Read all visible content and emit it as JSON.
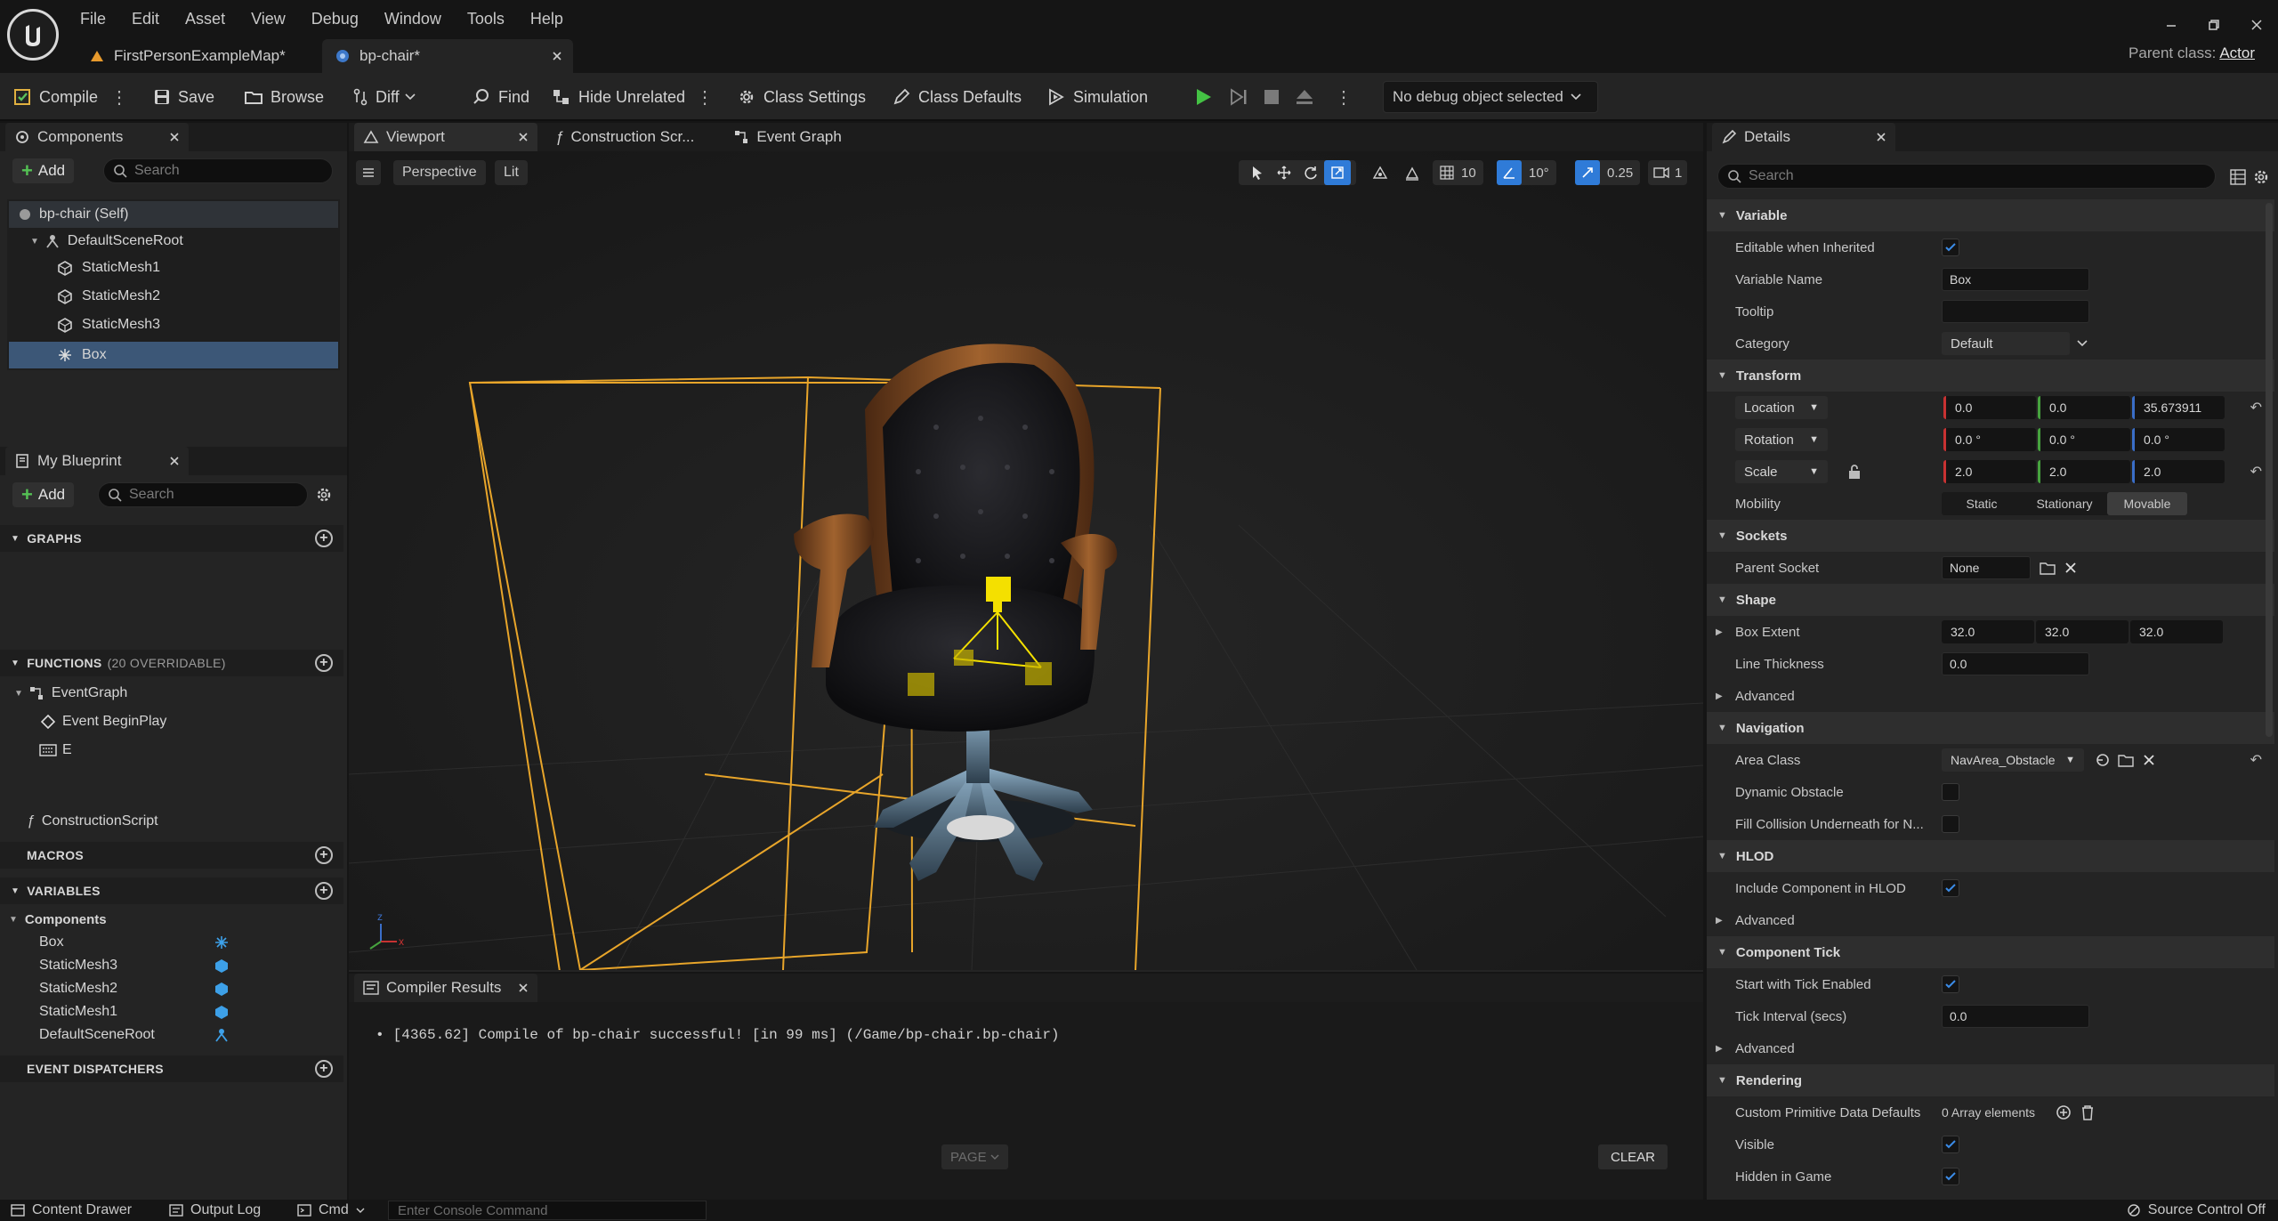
{
  "menu": [
    "File",
    "Edit",
    "Asset",
    "View",
    "Debug",
    "Window",
    "Tools",
    "Help"
  ],
  "doc_tabs": {
    "map": "FirstPersonExampleMap*",
    "bp": "bp-chair*"
  },
  "parent_class": {
    "label": "Parent class:",
    "value": "Actor"
  },
  "toolbar": {
    "compile": "Compile",
    "save": "Save",
    "browse": "Browse",
    "diff": "Diff",
    "find": "Find",
    "hide_unrelated": "Hide Unrelated",
    "class_settings": "Class Settings",
    "class_defaults": "Class Defaults",
    "simulation": "Simulation",
    "debug_object": "No debug object selected"
  },
  "components": {
    "title": "Components",
    "add": "Add",
    "search_placeholder": "Search",
    "items": [
      "bp-chair (Self)",
      "DefaultSceneRoot",
      "StaticMesh1",
      "StaticMesh2",
      "StaticMesh3",
      "Box"
    ]
  },
  "my_blueprint": {
    "title": "My Blueprint",
    "add": "Add",
    "search_placeholder": "Search",
    "graphs_label": "GRAPHS",
    "graphs": [
      "EventGraph",
      "Event BeginPlay",
      "E"
    ],
    "functions_label": "FUNCTIONS",
    "functions_count": "(20 OVERRIDABLE)",
    "functions": [
      "ConstructionScript"
    ],
    "macros_label": "MACROS",
    "variables_label": "VARIABLES",
    "var_group": "Components",
    "variables": [
      "Box",
      "StaticMesh3",
      "StaticMesh2",
      "StaticMesh1",
      "DefaultSceneRoot"
    ],
    "dispatchers_label": "EVENT DISPATCHERS"
  },
  "editor_tabs": {
    "viewport": "Viewport",
    "construction": "Construction Scr...",
    "event_graph": "Event Graph"
  },
  "viewport": {
    "perspective": "Perspective",
    "lit": "Lit",
    "grid_snap": "10",
    "rot_snap": "10°",
    "scale_snap": "0.25",
    "camera_speed": "1"
  },
  "compiler": {
    "title": "Compiler Results",
    "message": "[4365.62] Compile of bp-chair successful! [in 99 ms] (/Game/bp-chair.bp-chair)",
    "page": "PAGE",
    "clear": "CLEAR"
  },
  "details": {
    "title": "Details",
    "search_placeholder": "Search",
    "variable": {
      "cat": "Variable",
      "editable_inherited": "Editable when Inherited",
      "var_name_label": "Variable Name",
      "var_name": "Box",
      "tooltip_label": "Tooltip",
      "category_label": "Category",
      "category": "Default"
    },
    "transform": {
      "cat": "Transform",
      "location": "Location",
      "rotation": "Rotation",
      "scale": "Scale",
      "mobility": "Mobility",
      "loc": [
        "0.0",
        "0.0",
        "35.673911"
      ],
      "rot": [
        "0.0 °",
        "0.0 °",
        "0.0 °"
      ],
      "scl": [
        "2.0",
        "2.0",
        "2.0"
      ],
      "mobility_opts": [
        "Static",
        "Stationary",
        "Movable"
      ]
    },
    "sockets": {
      "cat": "Sockets",
      "parent_socket": "Parent Socket",
      "value": "None"
    },
    "shape": {
      "cat": "Shape",
      "box_extent": "Box Extent",
      "extent": [
        "32.0",
        "32.0",
        "32.0"
      ],
      "line_thickness": "Line Thickness",
      "thickness": "0.0",
      "advanced": "Advanced"
    },
    "navigation": {
      "cat": "Navigation",
      "area_class": "Area Class",
      "area_value": "NavArea_Obstacle",
      "dynamic_obstacle": "Dynamic Obstacle",
      "fill_collision": "Fill Collision Underneath for N..."
    },
    "hlod": {
      "cat": "HLOD",
      "include": "Include Component in HLOD",
      "advanced": "Advanced"
    },
    "tick": {
      "cat": "Component Tick",
      "start_enabled": "Start with Tick Enabled",
      "interval_label": "Tick Interval (secs)",
      "interval": "0.0",
      "advanced": "Advanced"
    },
    "rendering": {
      "cat": "Rendering",
      "custom_prim": "Custom Primitive Data Defaults",
      "array": "0 Array elements",
      "visible": "Visible",
      "hidden": "Hidden in Game"
    }
  },
  "statusbar": {
    "content_drawer": "Content Drawer",
    "output_log": "Output Log",
    "cmd": "Cmd",
    "console_placeholder": "Enter Console Command",
    "source_control": "Source Control Off"
  },
  "colors": {
    "accent": "#2f7bd8",
    "play": "#44c244",
    "selection": "#3c5777",
    "bbox": "#e8a52a"
  }
}
